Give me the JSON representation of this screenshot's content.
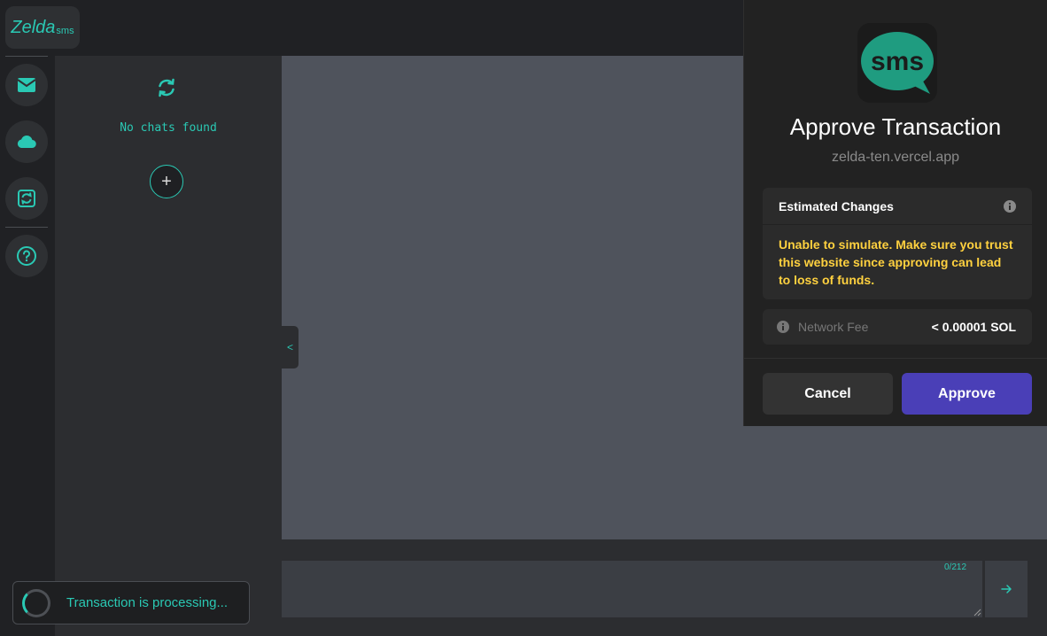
{
  "logo": {
    "name": "Zelda",
    "suffix": "sms"
  },
  "nav": {
    "items": [
      {
        "icon": "mail-icon"
      },
      {
        "icon": "cloud-icon"
      },
      {
        "icon": "sync-icon"
      },
      {
        "icon": "help-icon"
      }
    ]
  },
  "chat_list": {
    "refresh_icon": "refresh-icon",
    "empty_text": "No chats found",
    "add_button_label": "+"
  },
  "composer": {
    "collapse_label": "<",
    "message_value": "",
    "char_count": "0/212",
    "send_icon": "arrow-right-icon"
  },
  "toast": {
    "text": "Transaction is processing..."
  },
  "wallet": {
    "app_icon_text": "sms",
    "title": "Approve Transaction",
    "origin": "zelda-ten.vercel.app",
    "estimated_changes": {
      "title": "Estimated Changes",
      "warning": "Unable to simulate. Make sure you trust this website since approving can lead to loss of funds."
    },
    "network_fee": {
      "label": "Network Fee",
      "value": "< 0.00001 SOL"
    },
    "cancel_label": "Cancel",
    "approve_label": "Approve"
  },
  "colors": {
    "accent": "#2ac9b4",
    "warning": "#ffd13f",
    "approve": "#4a3fb7",
    "background": "#202124",
    "main_area": "#4f535c"
  }
}
